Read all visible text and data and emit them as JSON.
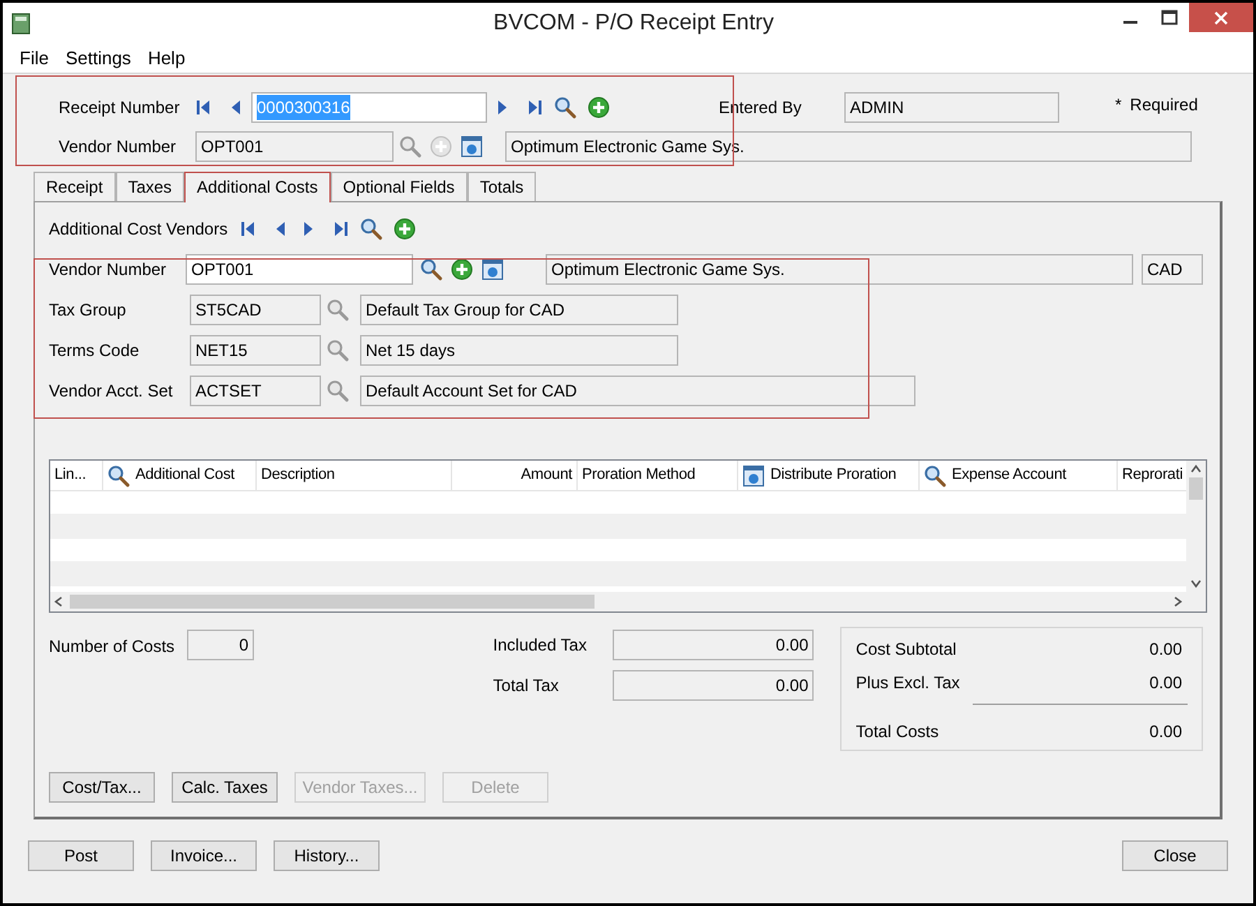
{
  "window": {
    "title": "BVCOM - P/O Receipt Entry"
  },
  "menu": [
    "File",
    "Settings",
    "Help"
  ],
  "header": {
    "receipt_number": {
      "label": "Receipt Number",
      "value": "0000300316",
      "highlighted": true
    },
    "vendor_number": {
      "label": "Vendor Number",
      "value": "OPT001",
      "description": "Optimum Electronic Game Sys.",
      "add_disabled": true
    },
    "entered_by": {
      "label": "Entered By",
      "value": "ADMIN"
    },
    "required_mark": "*",
    "required_label": "Required"
  },
  "tabs": [
    {
      "label": "Receipt",
      "selected": false
    },
    {
      "label": "Taxes",
      "selected": false
    },
    {
      "label": "Additional Costs",
      "selected": true
    },
    {
      "label": "Optional Fields",
      "selected": false
    },
    {
      "label": "Totals",
      "selected": false
    }
  ],
  "vendors_nav_label": "Additional Cost Vendors",
  "vendor": {
    "label": "Vendor Number",
    "value": "OPT001",
    "description": "Optimum Electronic Game Sys.",
    "currency": "CAD"
  },
  "vendor_fields": [
    {
      "label": "Tax Group",
      "value": "ST5CAD",
      "description": "Default Tax Group for CAD",
      "wide": false
    },
    {
      "label": "Terms Code",
      "value": "NET15",
      "description": "Net 15 days",
      "wide": false
    },
    {
      "label": "Vendor Acct. Set",
      "value": "ACTSET",
      "description": "Default Account Set for CAD",
      "wide": true
    }
  ],
  "table": {
    "columns": [
      {
        "label": "Lin...",
        "kind": "text"
      },
      {
        "label": "Additional Cost",
        "kind": "lookup"
      },
      {
        "label": "Description",
        "kind": "text"
      },
      {
        "label": "Amount",
        "kind": "numeric"
      },
      {
        "label": "Proration Method",
        "kind": "text"
      },
      {
        "label": "Distribute Proration",
        "kind": "finder"
      },
      {
        "label": "Expense Account",
        "kind": "lookup"
      },
      {
        "label": "Reprorati",
        "kind": "text"
      }
    ]
  },
  "number_of_costs": {
    "label": "Number of Costs",
    "value": "0"
  },
  "taxes": [
    {
      "label": "Included Tax",
      "value": "0.00"
    },
    {
      "label": "Total Tax",
      "value": "0.00"
    }
  ],
  "totals": [
    {
      "label": "Cost Subtotal",
      "value": "0.00"
    },
    {
      "label": "Plus Excl. Tax",
      "value": "0.00"
    },
    {
      "label": "Total Costs",
      "value": "0.00"
    }
  ],
  "panel_buttons": [
    {
      "label": "Cost/Tax...",
      "disabled": false
    },
    {
      "label": "Calc. Taxes",
      "disabled": false
    },
    {
      "label": "Vendor Taxes...",
      "disabled": true
    },
    {
      "label": "Delete",
      "disabled": true
    }
  ],
  "footer_buttons": [
    {
      "label": "Post"
    },
    {
      "label": "Invoice..."
    },
    {
      "label": "History..."
    },
    {
      "label": "Close"
    }
  ]
}
